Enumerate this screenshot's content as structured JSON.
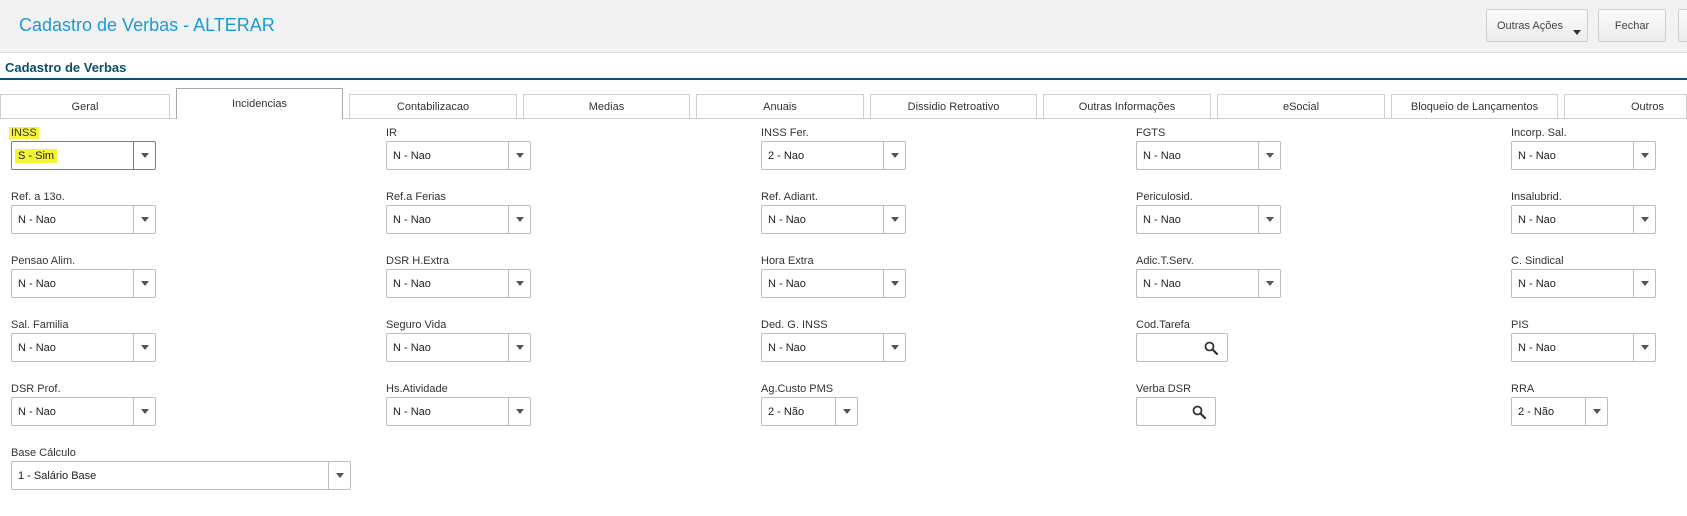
{
  "header": {
    "title": "Cadastro de Verbas - ALTERAR",
    "buttons": {
      "outras_acoes": "Outras Ações",
      "fechar": "Fechar"
    }
  },
  "section": {
    "title": "Cadastro de Verbas"
  },
  "tabs": [
    {
      "label": "Geral"
    },
    {
      "label": "Incidencias",
      "active": true
    },
    {
      "label": "Contabilizacao"
    },
    {
      "label": "Medias"
    },
    {
      "label": "Anuais"
    },
    {
      "label": "Dissidio Retroativo"
    },
    {
      "label": "Outras Informações"
    },
    {
      "label": "eSocial"
    },
    {
      "label": "Bloqueio de Lançamentos"
    },
    {
      "label": "Outros"
    }
  ],
  "fields": {
    "inss": {
      "label": "INSS",
      "value": "S - Sim"
    },
    "ir": {
      "label": "IR",
      "value": "N - Nao"
    },
    "inss_fer": {
      "label": "INSS Fer.",
      "value": "2 - Nao"
    },
    "fgts": {
      "label": "FGTS",
      "value": "N - Nao"
    },
    "incorp_sal": {
      "label": "Incorp. Sal.",
      "value": "N - Nao"
    },
    "ref_13o": {
      "label": "Ref. a 13o.",
      "value": "N - Nao"
    },
    "ref_ferias": {
      "label": "Ref.a Ferias",
      "value": "N - Nao"
    },
    "ref_adiant": {
      "label": "Ref. Adiant.",
      "value": "N - Nao"
    },
    "periculosid": {
      "label": "Periculosid.",
      "value": "N - Nao"
    },
    "insalubrid": {
      "label": "Insalubrid.",
      "value": "N - Nao"
    },
    "pensao_alim": {
      "label": "Pensao Alim.",
      "value": "N - Nao"
    },
    "dsr_hextra": {
      "label": "DSR H.Extra",
      "value": "N - Nao"
    },
    "hora_extra": {
      "label": "Hora Extra",
      "value": "N - Nao"
    },
    "adic_tserv": {
      "label": "Adic.T.Serv.",
      "value": "N - Nao"
    },
    "c_sindical": {
      "label": "C. Sindical",
      "value": "N - Nao"
    },
    "sal_familia": {
      "label": "Sal. Familia",
      "value": "N - Nao"
    },
    "seguro_vida": {
      "label": "Seguro Vida",
      "value": "N - Nao"
    },
    "ded_g_inss": {
      "label": "Ded. G. INSS",
      "value": "N - Nao"
    },
    "cod_tarefa": {
      "label": "Cod.Tarefa",
      "value": ""
    },
    "pis": {
      "label": "PIS",
      "value": "N - Nao"
    },
    "dsr_prof": {
      "label": "DSR Prof.",
      "value": "N - Nao"
    },
    "hs_atividade": {
      "label": "Hs.Atividade",
      "value": "N - Nao"
    },
    "ag_custo_pms": {
      "label": "Ag.Custo PMS",
      "value": "2 - Não"
    },
    "verba_dsr": {
      "label": "Verba DSR",
      "value": ""
    },
    "rra": {
      "label": "RRA",
      "value": "2 - Não"
    },
    "base_calculo": {
      "label": "Base Cálculo",
      "value": "1 - Salário Base"
    }
  },
  "colors": {
    "title": "#1a9bd7",
    "section": "#0b4f6c",
    "highlight": "#f4f43a",
    "focus_border": "#3a8fd0"
  },
  "icons": {
    "dropdown": "chevron-down-icon",
    "lookup": "search-icon"
  }
}
